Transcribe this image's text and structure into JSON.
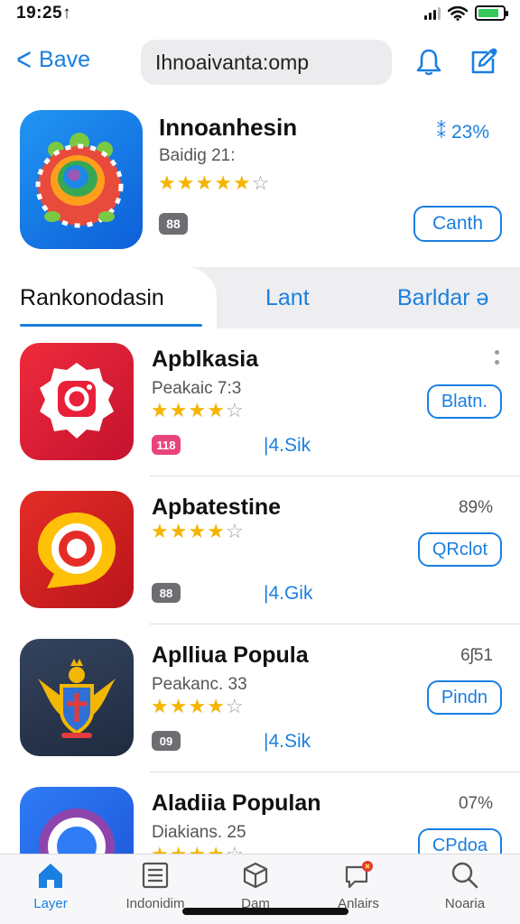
{
  "status_bar": {
    "time": "19:25↑"
  },
  "nav": {
    "back_label": "Bave",
    "url": "Ihnoaivanta:omp",
    "icons": [
      "bell-icon",
      "compose-icon"
    ]
  },
  "featured": {
    "title": "Innoanhesin",
    "subtitle": "Baidig 21:",
    "rating": 5,
    "rating_max": 6,
    "badge": "88",
    "percent": "⁑ 23%",
    "button": "Canth"
  },
  "tabs": [
    {
      "label": "Rankonodasin",
      "active": true
    },
    {
      "label": "Lant",
      "active": false
    },
    {
      "label": "Barldar ə",
      "active": false
    }
  ],
  "apps": [
    {
      "name": "Apblkasia",
      "subtitle": "Peakaic 7:3",
      "rating": 4,
      "rating_max": 5,
      "badge": "118",
      "badge_color": "#e8457a",
      "count": "|4.Sik",
      "meta": "",
      "button": "Blatn.",
      "icon": "instagram-style-icon"
    },
    {
      "name": "Apbatestine",
      "subtitle": "",
      "rating": 4,
      "rating_max": 5,
      "badge": "88",
      "badge_color": "#6d6d72",
      "count": "|4.Gik",
      "meta": "89%",
      "button": "QRclot",
      "icon": "chat-bubble-camera-icon"
    },
    {
      "name": "Aplliua Popula",
      "subtitle": "Peakanc. 33",
      "rating": 4,
      "rating_max": 5,
      "badge": "09",
      "badge_color": "#6d6d72",
      "count": "|4.Sik",
      "meta": "6ʃ51",
      "button": "Pindn",
      "icon": "eagle-crest-icon"
    },
    {
      "name": "Aladiia Populan",
      "subtitle": "Diakians. 25",
      "rating": 4,
      "rating_max": 5,
      "badge": "",
      "badge_color": "",
      "count": "",
      "meta": "07%",
      "button": "CPdoa",
      "icon": "ring-target-icon"
    }
  ],
  "tab_bar": [
    {
      "label": "Layer",
      "icon": "home-icon",
      "active": true
    },
    {
      "label": "Indonidim",
      "icon": "list-icon",
      "active": false
    },
    {
      "label": "Dam",
      "icon": "box-icon",
      "active": false
    },
    {
      "label": "Anlairs",
      "icon": "chat-badge-icon",
      "active": false
    },
    {
      "label": "Noaria",
      "icon": "search-icon",
      "active": false
    }
  ],
  "colors": {
    "accent": "#1a7fe0",
    "star": "#f4b400",
    "battery": "#34c759"
  }
}
